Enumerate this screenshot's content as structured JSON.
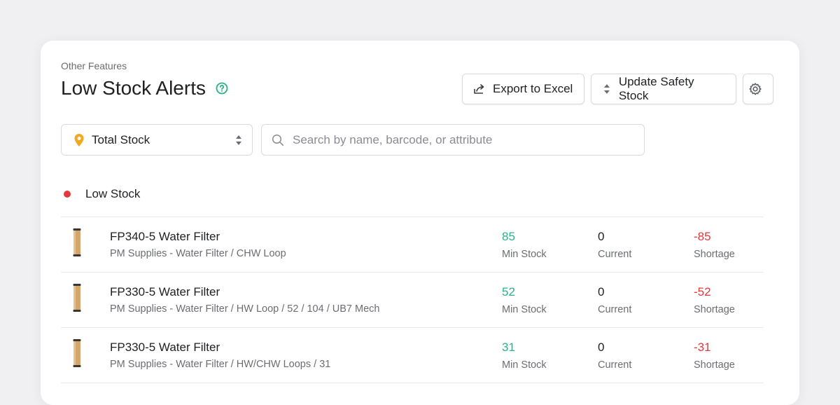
{
  "breadcrumb": "Other Features",
  "page_title": "Low Stock Alerts",
  "toolbar": {
    "export_label": "Export to Excel",
    "update_label": "Update Safety Stock"
  },
  "filters": {
    "location_select": "Total Stock",
    "search_placeholder": "Search by name, barcode, or attribute"
  },
  "section": {
    "title": "Low Stock"
  },
  "colors": {
    "accent_green": "#2bb08a",
    "alert_red": "#e5383b",
    "pin_orange": "#f4a81d"
  },
  "items": [
    {
      "name": "FP340-5 Water Filter",
      "path": "PM Supplies - Water Filter / CHW Loop",
      "min_stock": "85",
      "min_label": "Min Stock",
      "current": "0",
      "current_label": "Current",
      "shortage": "-85",
      "shortage_label": "Shortage"
    },
    {
      "name": "FP330-5 Water Filter",
      "path": "PM Supplies - Water Filter / HW Loop / 52 / 104 / UB7 Mech",
      "min_stock": "52",
      "min_label": "Min Stock",
      "current": "0",
      "current_label": "Current",
      "shortage": "-52",
      "shortage_label": "Shortage"
    },
    {
      "name": "FP330-5 Water Filter",
      "path": "PM Supplies - Water Filter / HW/CHW Loops / 31",
      "min_stock": "31",
      "min_label": "Min Stock",
      "current": "0",
      "current_label": "Current",
      "shortage": "-31",
      "shortage_label": "Shortage"
    }
  ]
}
